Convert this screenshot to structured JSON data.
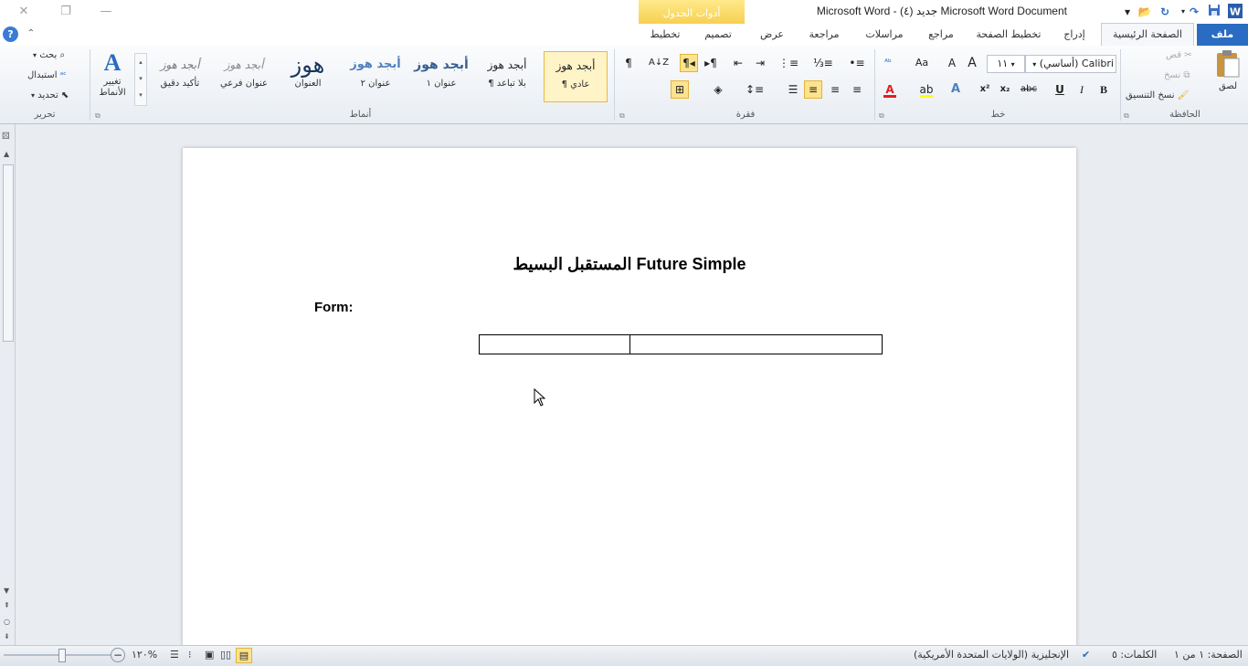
{
  "window": {
    "title": "Microsoft Word  -  (٤) جديد Microsoft Word Document",
    "contextual_tab_group": "أدوات الجدول"
  },
  "tabs": {
    "file": "ملف",
    "home": "الصفحة الرئيسية",
    "insert": "إدراج",
    "page_layout": "تخطيط الصفحة",
    "references": "مراجع",
    "mailings": "مراسلات",
    "review": "مراجعة",
    "view": "عرض",
    "design": "تصميم",
    "layout": "تخطيط"
  },
  "clipboard": {
    "label": "الحافظة",
    "paste": "لصق",
    "cut": "قص",
    "copy": "نسخ",
    "format_painter": "نسخ التنسيق"
  },
  "font": {
    "label": "خط",
    "name": "(أساسي) Calibri",
    "size": "١١",
    "grow_label": "A",
    "shrink_label": "A",
    "case_label": "Aa",
    "bold": "B",
    "italic": "I",
    "underline": "U",
    "strike": "abc",
    "subscript": "x₂",
    "superscript": "x²",
    "font_color": "A",
    "text_effects": "A"
  },
  "paragraph": {
    "label": "فقرة"
  },
  "styles": {
    "label": "أنماط",
    "items": [
      {
        "preview": "أبجد هوز",
        "name": "¶ عادي"
      },
      {
        "preview": "أبجد هوز",
        "name": "¶ بلا تباعد"
      },
      {
        "preview": "أبجد هوز",
        "name": "عنوان ١"
      },
      {
        "preview": "أبجد هوز",
        "name": "عنوان ٢"
      },
      {
        "preview": "هوز",
        "name": "العنوان"
      },
      {
        "preview": "أبجد هوز",
        "name": "عنوان فرعي"
      },
      {
        "preview": "أبجد هوز",
        "name": "تأكيد دقيق"
      }
    ],
    "change_styles": "تغيير الأنماط"
  },
  "editing": {
    "label": "تحرير",
    "find": "بحث",
    "replace": "استبدال",
    "select": "تحديد"
  },
  "document": {
    "title": "المستقبل البسيط Future Simple",
    "form_label": "Form:"
  },
  "status": {
    "page": "الصفحة: ١ من ١",
    "words": "الكلمات: ٥",
    "language": "الإنجليزية (الولايات المتحدة الأمريكية)",
    "zoom": "١٢٠%"
  },
  "colors": {
    "file_tab": "#2a6cc2",
    "contextual": "#f6cf4f",
    "font_color_bar": "#e02020",
    "highlight_bar": "#ffff00"
  }
}
